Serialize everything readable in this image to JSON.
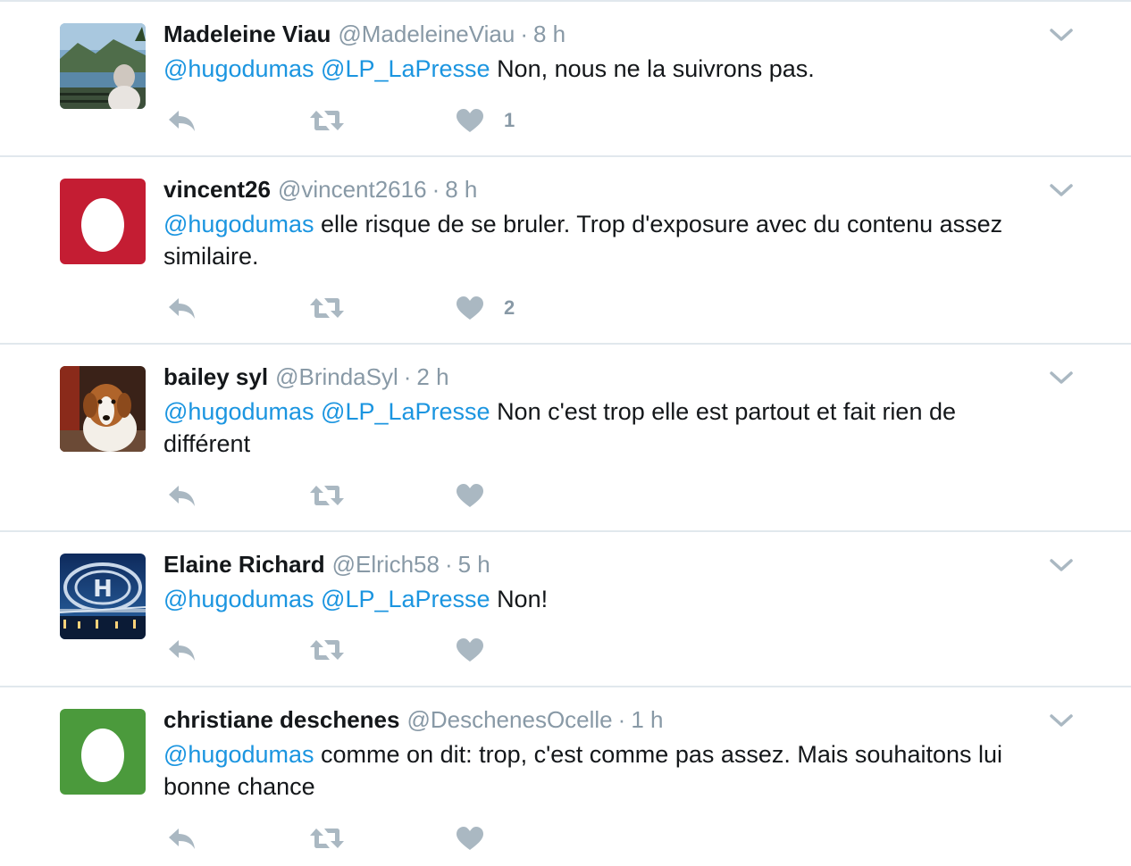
{
  "tweets": [
    {
      "name": "Madeleine Viau",
      "handle": "@MadeleineViau",
      "dot": "·",
      "time": "8 h",
      "mention1": "@hugodumas",
      "mention2": "@LP_LaPresse",
      "body": "Non, nous ne la suivrons pas.",
      "likes": "1",
      "avatar": "photo-landscape-woman"
    },
    {
      "name": "vincent26",
      "handle": "@vincent2616",
      "dot": "·",
      "time": "8 h",
      "mention1": "@hugodumas",
      "body": "elle risque de se bruler. Trop d'exposure avec du contenu assez similaire.",
      "likes": "2",
      "avatar": "egg-red"
    },
    {
      "name": "bailey syl",
      "handle": "@BrindaSyl",
      "dot": "·",
      "time": "2 h",
      "mention1": "@hugodumas",
      "mention2": "@LP_LaPresse",
      "body": "Non c'est trop elle est partout et fait rien de différent",
      "avatar": "photo-dog"
    },
    {
      "name": "Elaine Richard",
      "handle": "@Elrich58",
      "dot": "·",
      "time": "5 h",
      "mention1": "@hugodumas",
      "mention2": "@LP_LaPresse",
      "body": "Non!",
      "avatar": "photo-canadiens-logo"
    },
    {
      "name": "christiane deschenes",
      "handle": "@DeschenesOcelle",
      "dot": "·",
      "time": "1 h",
      "mention1": "@hugodumas",
      "body": "comme on dit: trop, c'est comme pas assez. Mais souhaitons lui bonne chance",
      "avatar": "egg-green"
    }
  ],
  "icons": {
    "reply": "reply-icon",
    "retweet": "retweet-icon",
    "like": "heart-icon",
    "more": "chevron-down-icon"
  },
  "colors": {
    "mention": "#1b95e0",
    "muted": "#8899a6",
    "egg_red": "#c41d33",
    "egg_green": "#4b9a3c",
    "divider": "#e1e8ed"
  }
}
